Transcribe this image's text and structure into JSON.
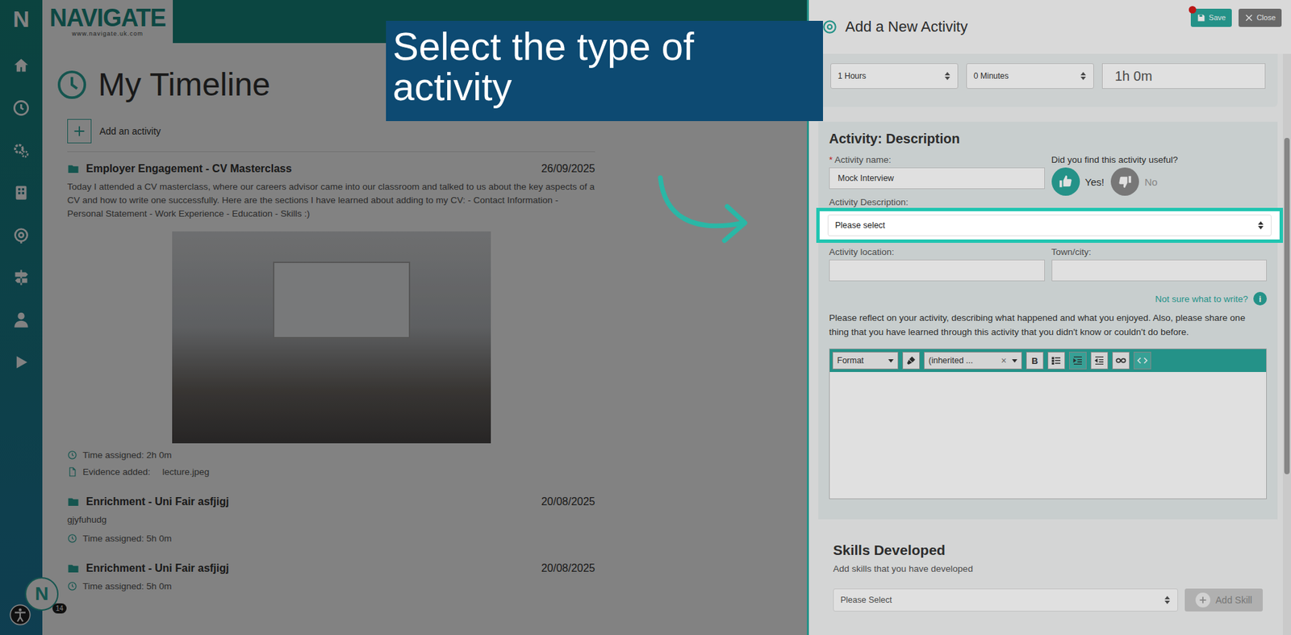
{
  "tutorial": {
    "callout": "Select the type of activity"
  },
  "sidebar": {
    "logo": "N"
  },
  "header": {
    "logo": "NAVIGATE",
    "url": "www.navigate.uk.com"
  },
  "timeline": {
    "title": "My Timeline",
    "add_button": "Add an activity",
    "entries": [
      {
        "title": "Employer Engagement - CV Masterclass",
        "date": "26/09/2025",
        "description": "Today I attended a CV masterclass, where our careers advisor came into our classroom and talked to us about the key aspects of a CV and how to write one successfully. Here are the sections I have learned about adding to my CV: - Contact Information - Personal Statement - Work Experience - Education - Skills :)",
        "photo": true,
        "time": "Time assigned: 2h 0m",
        "evidence_label": "Evidence added:",
        "evidence_file": "lecture.jpeg"
      },
      {
        "title": "Enrichment - Uni Fair asfjigj",
        "date": "20/08/2025",
        "description": "gjyfuhudg",
        "photo": false,
        "time": "Time assigned: 5h 0m"
      },
      {
        "title": "Enrichment - Uni Fair asfjigj",
        "date": "20/08/2025",
        "photo": false,
        "time": "Time assigned: 5h 0m"
      }
    ]
  },
  "panel": {
    "title": "Add a New Activity",
    "save": "Save",
    "close": "Close",
    "duration": {
      "hours": "1 Hours",
      "minutes": "0 Minutes",
      "total": "1h 0m"
    },
    "section_title": "Activity: Description",
    "name": {
      "label": "Activity name:",
      "required": "*",
      "value": "Mock Interview"
    },
    "useful": {
      "question": "Did you find this activity useful?",
      "options": [
        {
          "label": "Yes!",
          "selected": true
        },
        {
          "label": "No",
          "selected": false
        }
      ]
    },
    "description_type": {
      "label": "Activity Description:",
      "placeholder": "Please select"
    },
    "location": {
      "label": "Activity location:"
    },
    "town": {
      "label": "Town/city:"
    },
    "help_link": "Not sure what to write?",
    "help_icon": "i",
    "prompt": "Please reflect on your activity, describing what happened and what you enjoyed. Also, please share one thing that you have learned through this activity that you didn't know or couldn't do before.",
    "toolbar": {
      "format": "Format",
      "font": "(inherited ...",
      "clear": "×",
      "bold": "B"
    },
    "skills": {
      "title": "Skills Developed",
      "subtitle": "Add skills that you have developed",
      "placeholder": "Please Select",
      "add": "Add Skill"
    }
  },
  "help_badge": {
    "label": "N",
    "count": "14"
  }
}
